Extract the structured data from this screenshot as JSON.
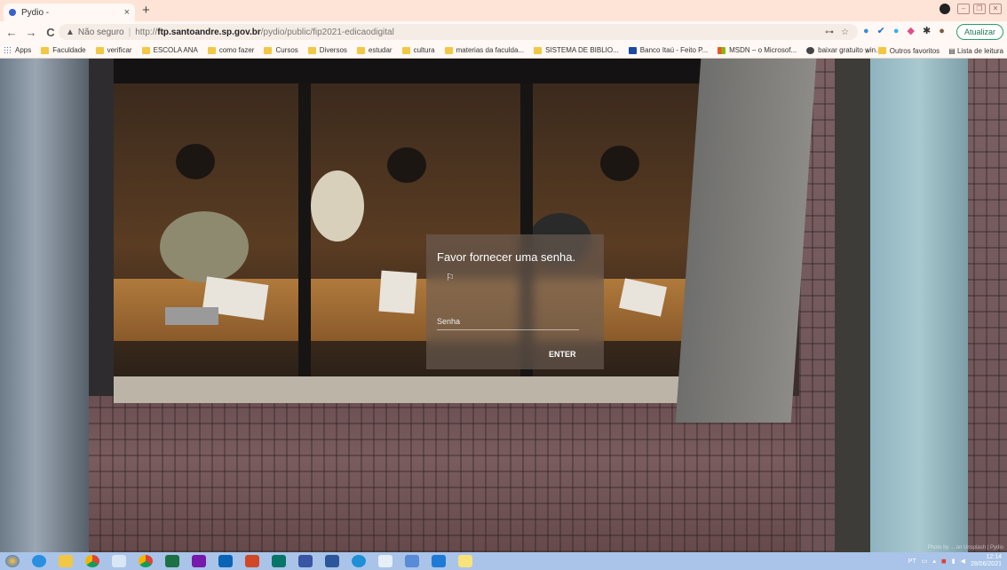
{
  "browser": {
    "tab_title": "Pydio -",
    "tab_close": "×",
    "new_tab": "+",
    "nav": {
      "back": "←",
      "forward": "→",
      "reload": "C"
    },
    "address": {
      "security_icon": "▲",
      "security_label": "Não seguro",
      "separator": "|",
      "url_prefix": "http://",
      "url_host": "ftp.santoandre.sp.gov.br",
      "url_path": "/pydio/public/fip2021-edicaodigital"
    },
    "update_button": "Atualizar"
  },
  "bookmarks": [
    {
      "label": "Apps",
      "icon": "apps"
    },
    {
      "label": "Faculdade",
      "icon": "folder"
    },
    {
      "label": "verificar",
      "icon": "folder"
    },
    {
      "label": "ESCOLA ANA",
      "icon": "folder"
    },
    {
      "label": "como fazer",
      "icon": "folder"
    },
    {
      "label": "Cursos",
      "icon": "folder"
    },
    {
      "label": "Diversos",
      "icon": "folder"
    },
    {
      "label": "estudar",
      "icon": "folder"
    },
    {
      "label": "cultura",
      "icon": "folder"
    },
    {
      "label": "materias da faculda...",
      "icon": "folder"
    },
    {
      "label": "SISTEMA DE BIBLIO...",
      "icon": "folder"
    },
    {
      "label": "Banco Itaú - Feito P...",
      "icon": "blue"
    },
    {
      "label": "MSDN – o Microsof...",
      "icon": "ms"
    },
    {
      "label": "baixar gratuito win...",
      "icon": "globe"
    }
  ],
  "bookmarks_right": {
    "more": "»",
    "other_favorites": "Outros favoritos",
    "reading_list": "Lista de leitura"
  },
  "login": {
    "title": "Favor fornecer uma senha.",
    "flag_icon": "⚐",
    "password_placeholder": "Senha",
    "enter_label": "ENTER"
  },
  "credit": "Photo by ... on Unsplash | Pydio",
  "taskbar": {
    "clock_time": "12:14",
    "clock_date": "28/06/2021",
    "lang": "PT"
  }
}
